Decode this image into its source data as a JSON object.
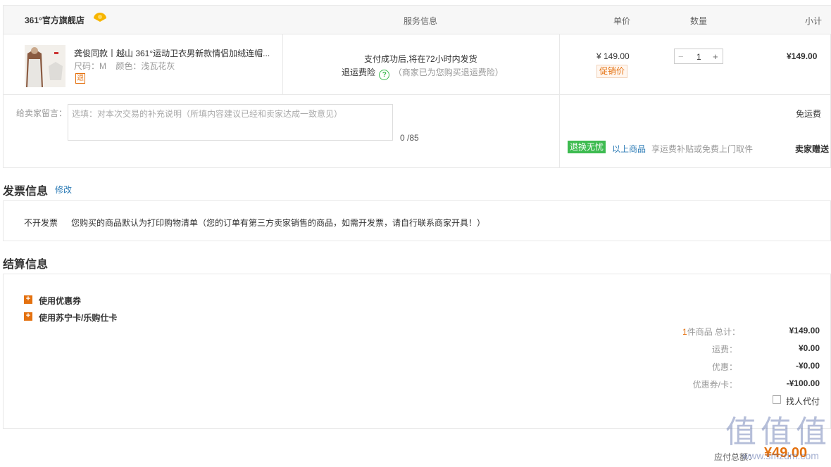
{
  "store": {
    "name": "361°官方旗舰店"
  },
  "table_header": {
    "service": "服务信息",
    "unit_price": "单价",
    "quantity": "数量",
    "subtotal": "小计"
  },
  "product": {
    "title": "龚俊同款丨越山 361°运动卫衣男新款情侣加绒连帽...",
    "size_label": "尺码：",
    "size": "M",
    "color_label": "颜色：",
    "color": "浅瓦花灰",
    "return_badge": "退",
    "service_line1": "支付成功后,将在72小时内发货",
    "service_insurance": "退运费险",
    "service_insurance_note": "（商家已为您购买退运费险）",
    "price": "¥ 149.00",
    "promo_tag": "促销价",
    "qty_minus": "−",
    "qty_value": "1",
    "qty_plus": "+",
    "subtotal": "¥149.00"
  },
  "message": {
    "label": "给卖家留言：",
    "placeholder": "选填：对本次交易的补充说明（所填内容建议已经和卖家达成一致意见）",
    "counter": "0 /85"
  },
  "shipping": {
    "free_shipping": "免运费",
    "badge": "退换无忧",
    "applies_to": "以上商品",
    "desc": "享运费补贴或免费上门取件",
    "gift": "卖家赠送"
  },
  "invoice": {
    "title": "发票信息",
    "edit_link": "修改",
    "type": "不开发票",
    "note": "您购买的商品默认为打印购物清单（您的订单有第三方卖家销售的商品，如需开发票，请自行联系商家开具！）"
  },
  "settlement": {
    "title": "结算信息",
    "coupon_toggle": "使用优惠券",
    "card_toggle": "使用苏宁卡/乐购仕卡",
    "items_count": "1",
    "items_label": "件商品 总计：",
    "total": "¥149.00",
    "shipping_label": "运费：",
    "shipping": "¥0.00",
    "discount_label": "优惠：",
    "discount": "-¥0.00",
    "coupon_label": "优惠券/卡：",
    "coupon": "-¥100.00",
    "proxy_pay": "找人代付"
  },
  "payable": {
    "label": "应付总额：",
    "amount": "¥49.00"
  },
  "watermark": {
    "text": "值 值 值",
    "url": "www.smzdm.com"
  },
  "colors": {
    "accent": "#e4710f",
    "green": "#3dbb50",
    "link": "#2a7ab5",
    "border": "#e8e8e8"
  }
}
